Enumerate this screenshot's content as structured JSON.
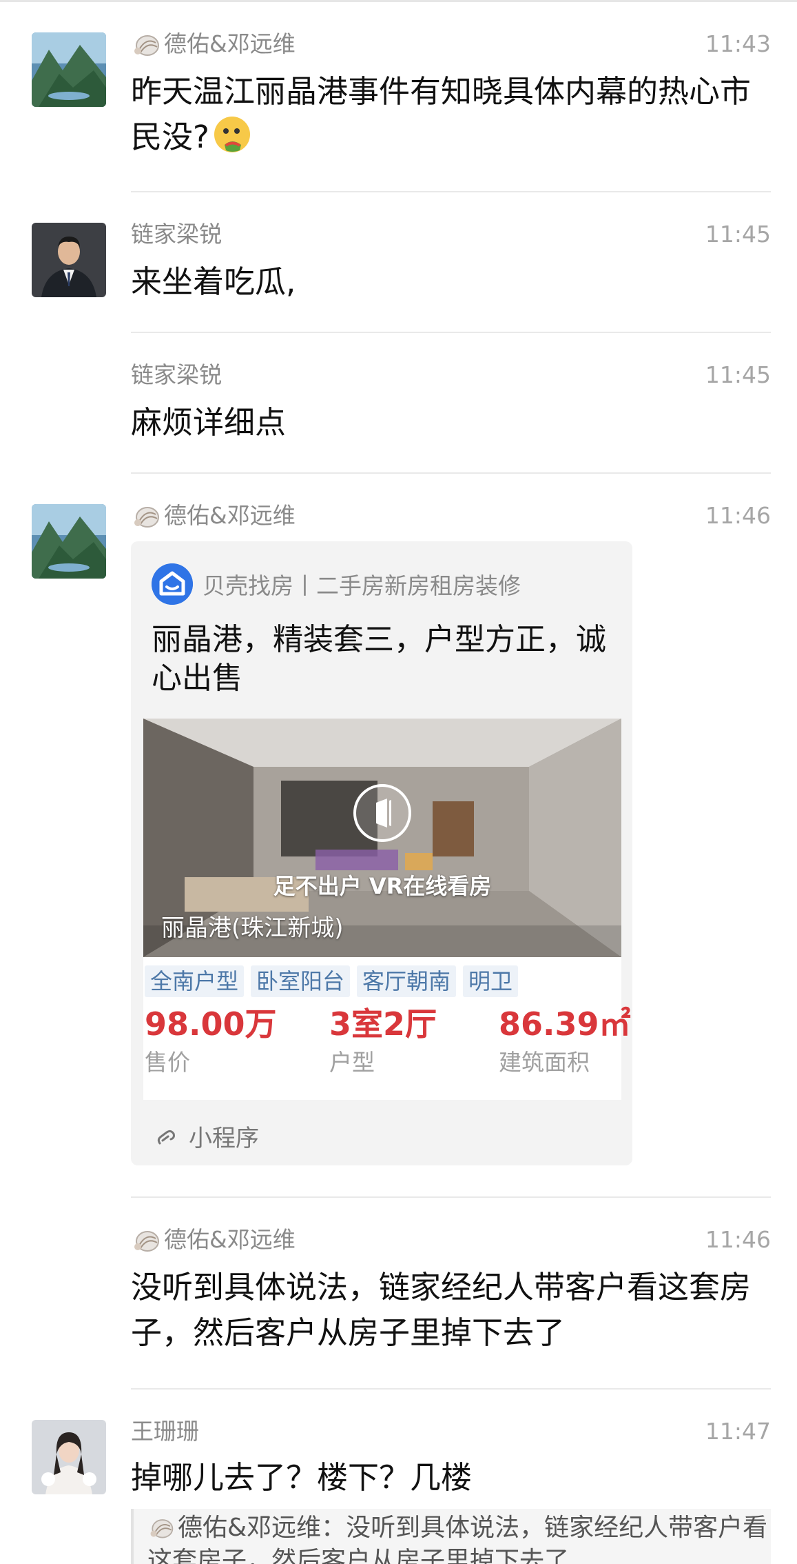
{
  "messages": [
    {
      "sender": "德佑&邓远维",
      "time": "11:43",
      "text": "昨天温江丽晶港事件有知晓具体内幕的热心市民没?"
    },
    {
      "sender": "链家梁锐",
      "time": "11:45",
      "text": "来坐着吃瓜,"
    },
    {
      "sender": "链家梁锐",
      "time": "11:45",
      "text": "麻烦详细点"
    },
    {
      "sender": "德佑&邓远维",
      "time": "11:46"
    },
    {
      "sender": "德佑&邓远维",
      "time": "11:46",
      "text": "没听到具体说法，链家经纪人带客户看这套房子，然后客户从房子里掉下去了"
    },
    {
      "sender": "王珊珊",
      "time": "11:47",
      "text": "掉哪儿去了？楼下？几楼"
    }
  ],
  "card": {
    "source": "贝壳找房丨二手房新房租房装修",
    "title": "丽晶港，精装套三，户型方正，诚心出售",
    "vr_label": "足不出户 VR在线看房",
    "place": "丽晶港(珠江新城)",
    "tags": [
      "全南户型",
      "卧室阳台",
      "客厅朝南",
      "明卫"
    ],
    "price": {
      "value": "98.00万",
      "label": "售价"
    },
    "layout": {
      "value": "3室2厅",
      "label": "户型"
    },
    "area": {
      "value": "86.39㎡",
      "label": "建筑面积"
    },
    "footer": "小程序"
  },
  "quote": {
    "text": "德佑&邓远维：没听到具体说法，链家经纪人带客户看这套房子，然后客户从房子里掉下去了"
  },
  "colors": {
    "price_red": "#d9373b",
    "tag_blue": "#4d78a8",
    "beike_blue": "#2f74e6"
  }
}
